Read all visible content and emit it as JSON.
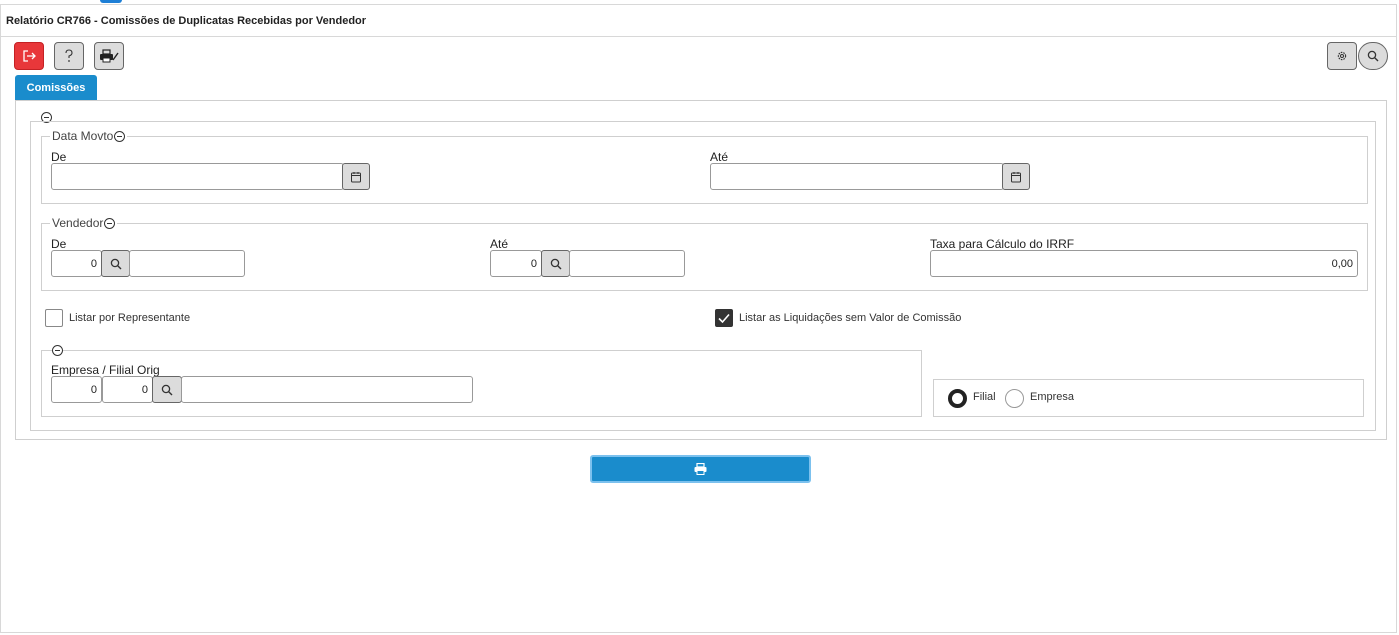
{
  "window": {
    "title": "Relatório CR766 - Comissões de Duplicatas Recebidas por Vendedor"
  },
  "toolbar": {
    "exit_icon": "exit-icon",
    "help_icon": "help-icon",
    "printer_setup_icon": "printer-setup-icon",
    "settings_icon": "gear-icon",
    "search_icon": "search-icon"
  },
  "tabs": [
    {
      "label": "Comissões",
      "active": true
    }
  ],
  "data_movto": {
    "legend": "Data Movto",
    "from_label": "De",
    "from_value": "",
    "to_label": "Até",
    "to_value": ""
  },
  "vendedor": {
    "legend": "Vendedor",
    "from_label": "De",
    "from_code": "0",
    "from_name": "",
    "to_label": "Até",
    "to_code": "0",
    "to_name": "",
    "irrf_label": "Taxa para Cálculo do IRRF",
    "irrf_value": "0,00"
  },
  "options": {
    "listar_representante_label": "Listar por Representante",
    "listar_representante_checked": false,
    "listar_liquidacoes_label": "Listar as Liquidações sem Valor de Comissão",
    "listar_liquidacoes_checked": true
  },
  "empresa": {
    "label": "Empresa / Filial Orig",
    "empresa_code": "0",
    "filial_code": "0",
    "name": ""
  },
  "scope": {
    "options": [
      "Filial",
      "Empresa"
    ],
    "selected": "Filial"
  },
  "actions": {
    "print_icon": "printer-icon"
  },
  "colors": {
    "accent": "#1a8ccc",
    "exit": "#e8373a"
  }
}
